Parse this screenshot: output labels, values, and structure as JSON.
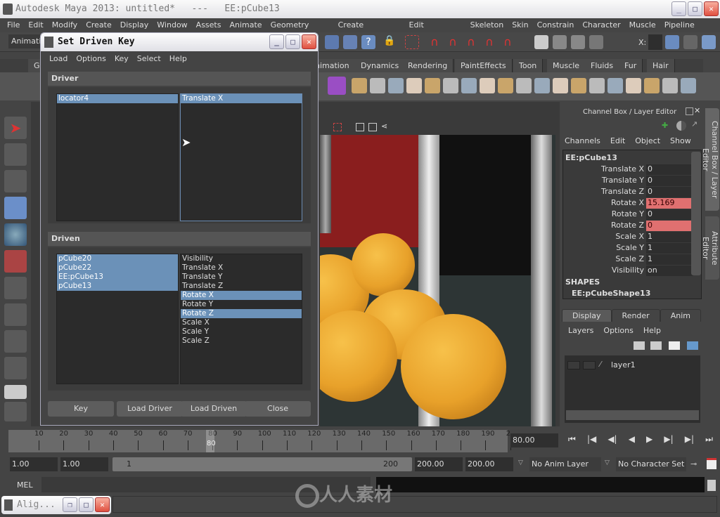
{
  "app": {
    "title": "Autodesk Maya 2013: untitled*   ---   EE:pCube13"
  },
  "menu": [
    "File",
    "Edit",
    "Modify",
    "Create",
    "Display",
    "Window",
    "Assets",
    "Animate",
    "Geometry Cache",
    "Create Deformers",
    "Edit Deformers",
    "Skeleton",
    "Skin",
    "Constrain",
    "Character",
    "Muscle",
    "Pipeline Cache"
  ],
  "status": {
    "mode": "Animation",
    "x_label": "X:"
  },
  "shelf_tabs": [
    "G",
    "nimation",
    "Dynamics",
    "Rendering",
    "PaintEffects",
    "Toon",
    "Muscle",
    "Fluids",
    "Fur",
    "Hair"
  ],
  "dialog": {
    "title": "Set Driven Key",
    "menu": [
      "Load",
      "Options",
      "Key",
      "Select",
      "Help"
    ],
    "driver_label": "Driver",
    "driver_objects": [
      {
        "label": "locator4",
        "selected": true
      }
    ],
    "driver_attrs": [
      {
        "label": "Translate X",
        "selected": true
      }
    ],
    "driven_label": "Driven",
    "driven_objects": [
      {
        "label": "pCube20",
        "selected": true
      },
      {
        "label": "pCube22",
        "selected": true
      },
      {
        "label": "EE:pCube13",
        "selected": true
      },
      {
        "label": "pCube13",
        "selected": true
      }
    ],
    "driven_attrs": [
      {
        "label": "Visibility",
        "selected": false
      },
      {
        "label": "Translate X",
        "selected": false
      },
      {
        "label": "Translate Y",
        "selected": false
      },
      {
        "label": "Translate Z",
        "selected": false
      },
      {
        "label": "Rotate X",
        "selected": true
      },
      {
        "label": "Rotate Y",
        "selected": false
      },
      {
        "label": "Rotate Z",
        "selected": true
      },
      {
        "label": "Scale X",
        "selected": false
      },
      {
        "label": "Scale Y",
        "selected": false
      },
      {
        "label": "Scale Z",
        "selected": false
      }
    ],
    "buttons": [
      "Key",
      "Load Driver",
      "Load Driven",
      "Close"
    ]
  },
  "channel_box": {
    "title": "Channel Box / Layer Editor",
    "menu": [
      "Channels",
      "Edit",
      "Object",
      "Show"
    ],
    "object": "EE:pCube13",
    "channels": [
      {
        "name": "Translate X",
        "value": "0",
        "keyed": false
      },
      {
        "name": "Translate Y",
        "value": "0",
        "keyed": false
      },
      {
        "name": "Translate Z",
        "value": "0",
        "keyed": false
      },
      {
        "name": "Rotate X",
        "value": "15.169",
        "keyed": true
      },
      {
        "name": "Rotate Y",
        "value": "0",
        "keyed": false
      },
      {
        "name": "Rotate Z",
        "value": "0",
        "keyed": true
      },
      {
        "name": "Scale X",
        "value": "1",
        "keyed": false
      },
      {
        "name": "Scale Y",
        "value": "1",
        "keyed": false
      },
      {
        "name": "Scale Z",
        "value": "1",
        "keyed": false
      },
      {
        "name": "Visibility",
        "value": "on",
        "keyed": false
      }
    ],
    "shapes_label": "SHAPES",
    "shape": "EE:pCubeShape13",
    "keyed_color": "#e07070"
  },
  "side_tabs": [
    "Channel Box / Layer Editor",
    "Attribute Editor"
  ],
  "layer_editor": {
    "tabs": [
      "Display",
      "Render",
      "Anim"
    ],
    "menu": [
      "Layers",
      "Options",
      "Help"
    ],
    "layers": [
      "layer1"
    ]
  },
  "timeline": {
    "ticks": [
      "10",
      "20",
      "30",
      "40",
      "50",
      "60",
      "70",
      "80",
      "90",
      "100",
      "110",
      "120",
      "130",
      "140",
      "150",
      "160",
      "170",
      "180",
      "190",
      "2"
    ],
    "current_frame_marker": "80",
    "current_frame": "80.00"
  },
  "range": {
    "start": "1.00",
    "playback_start": "1.00",
    "slider_start": "1",
    "slider_end": "200",
    "playback_end": "200.00",
    "end": "200.00",
    "anim_layer": "No Anim Layer",
    "character_set": "No Character Set"
  },
  "command": {
    "label": "MEL"
  },
  "minimized": {
    "title": "Alig..."
  },
  "watermark": "人人素材"
}
